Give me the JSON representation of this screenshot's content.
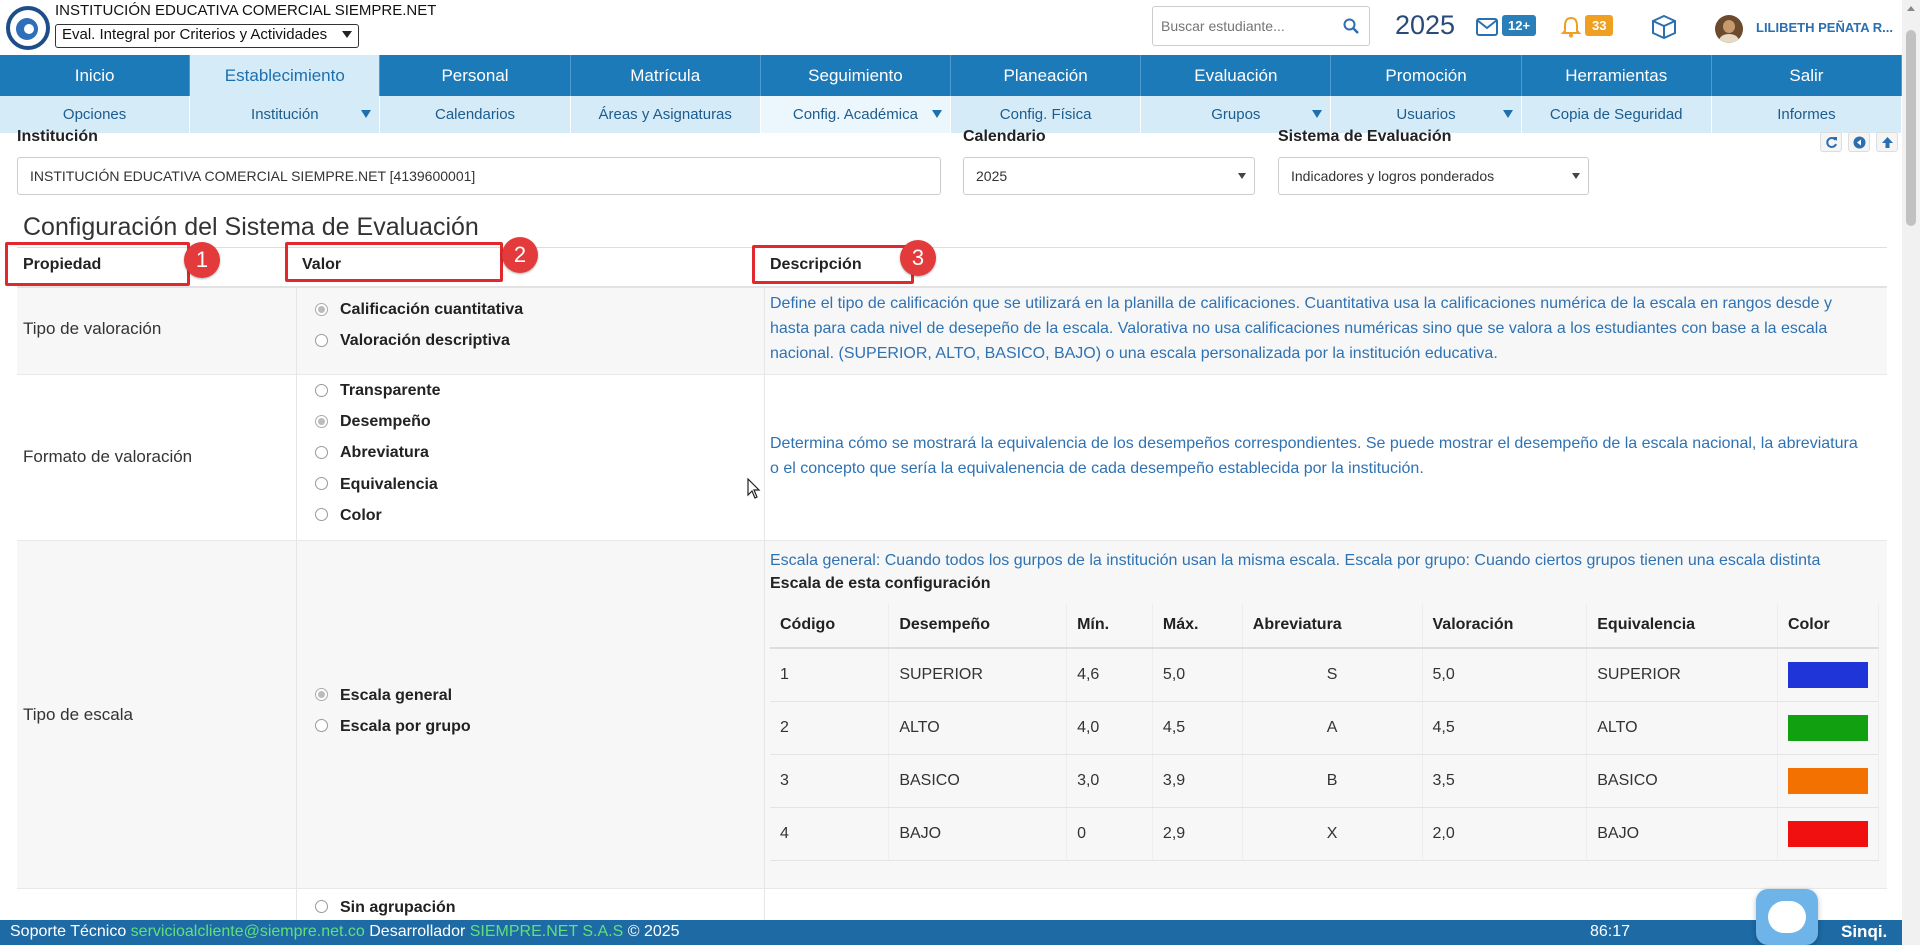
{
  "header": {
    "institution_name": "INSTITUCIÓN EDUCATIVA COMERCIAL SIEMPRE.NET",
    "profile_select": "Eval. Integral por Criterios y Actividades",
    "search_placeholder": "Buscar estudiante...",
    "year": "2025",
    "messages_count": "12+",
    "notifications_count": "33",
    "user_name": "LILIBETH PEÑATA R..."
  },
  "main_nav": [
    "Inicio",
    "Establecimiento",
    "Personal",
    "Matrícula",
    "Seguimiento",
    "Planeación",
    "Evaluación",
    "Promoción",
    "Herramientas",
    "Salir"
  ],
  "sub_nav": [
    "Opciones",
    "Institución",
    "Calendarios",
    "Áreas y Asignaturas",
    "Config. Académica",
    "Config. Física",
    "Grupos",
    "Usuarios",
    "Copia de Seguridad",
    "Informes"
  ],
  "filters": {
    "institution_label": "Institución",
    "institution_value": "INSTITUCIÓN EDUCATIVA COMERCIAL SIEMPRE.NET [4139600001]",
    "calendar_label": "Calendario",
    "calendar_value": "2025",
    "system_label": "Sistema de Evaluación",
    "system_value": "Indicadores y logros ponderados"
  },
  "page": {
    "title": "Configuración del Sistema de Evaluación",
    "col_property": "Propiedad",
    "col_value": "Valor",
    "col_description": "Descripción",
    "badges": [
      "1",
      "2",
      "3"
    ]
  },
  "rows": {
    "tipo_valoracion": {
      "label": "Tipo de valoración",
      "options": [
        "Calificación cuantitativa",
        "Valoración descriptiva"
      ],
      "selected": "Calificación cuantitativa",
      "description": "Define el tipo de calificación que se utilizará en la planilla de calificaciones. Cuantitativa usa la calificaciones numérica de la escala en rangos desde y hasta para cada nivel de desepeño de la escala. Valorativa no usa calificaciones numéricas sino que se valora a los estudiantes con base a la escala nacional. (SUPERIOR, ALTO, BASICO, BAJO) o una escala personalizada por la institución educativa."
    },
    "formato_valoracion": {
      "label": "Formato de valoración",
      "options": [
        "Transparente",
        "Desempeño",
        "Abreviatura",
        "Equivalencia",
        "Color"
      ],
      "selected": "Desempeño",
      "description": "Determina cómo se mostrará la equivalencia de los desempeños correspondientes. Se puede mostrar el desempeño de la escala nacional, la abreviatura o el concepto que sería la equivalenencia de cada desempeño establecida por la institución."
    },
    "tipo_escala": {
      "label": "Tipo de escala",
      "options": [
        "Escala general",
        "Escala por grupo"
      ],
      "selected": "Escala general",
      "description": "Escala general: Cuando todos los gurpos de la institución usan la misma escala. Escala por grupo: Cuando ciertos grupos tienen una escala distinta",
      "scale_title": "Escala de esta configuración"
    },
    "agrupacion": {
      "options": [
        "Sin agrupación"
      ]
    }
  },
  "scale_table": {
    "headers": [
      "Código",
      "Desempeño",
      "Mín.",
      "Máx.",
      "Abreviatura",
      "Valoración",
      "Equivalencia",
      "Color"
    ],
    "rows": [
      {
        "codigo": "1",
        "desempeno": "SUPERIOR",
        "min": "4,6",
        "max": "5,0",
        "abrev": "S",
        "valoracion": "5,0",
        "equivalencia": "SUPERIOR",
        "color": "#1f35d8"
      },
      {
        "codigo": "2",
        "desempeno": "ALTO",
        "min": "4,0",
        "max": "4,5",
        "abrev": "A",
        "valoracion": "4,5",
        "equivalencia": "ALTO",
        "color": "#10a010"
      },
      {
        "codigo": "3",
        "desempeno": "BASICO",
        "min": "3,0",
        "max": "3,9",
        "abrev": "B",
        "valoracion": "3,5",
        "equivalencia": "BASICO",
        "color": "#f27100"
      },
      {
        "codigo": "4",
        "desempeno": "BAJO",
        "min": "0",
        "max": "2,9",
        "abrev": "X",
        "valoracion": "2,0",
        "equivalencia": "BAJO",
        "color": "#f01010"
      }
    ]
  },
  "footer": {
    "support_label": "Soporte Técnico",
    "support_email": "servicioalcliente@siempre.net.co",
    "developer_label": "Desarrollador",
    "developer_name": "SIEMPRE.NET S.A.S",
    "copyright": "© 2025",
    "timer": "86:17",
    "logo_text": "Sinqi."
  }
}
